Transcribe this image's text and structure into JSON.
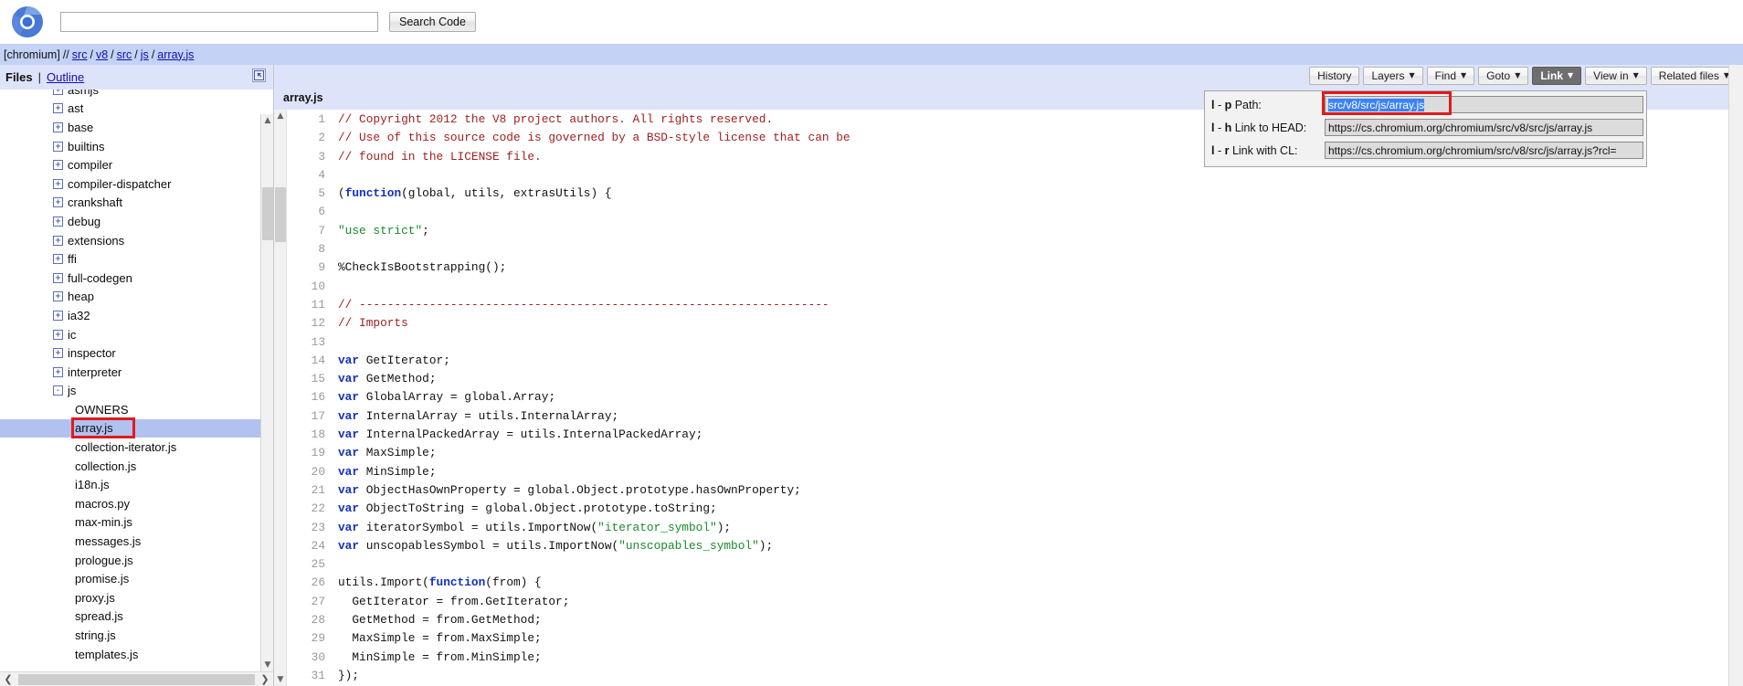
{
  "search": {
    "value": "",
    "placeholder": "",
    "button_label": "Search Code",
    "logo_icon": "chromium-logo-icon"
  },
  "breadcrumb": {
    "project": "[chromium]",
    "slashes": "//",
    "segments": [
      "src",
      "v8",
      "src",
      "js",
      "array.js"
    ]
  },
  "sidebar": {
    "files_label": "Files",
    "divider": "|",
    "outline_label": "Outline",
    "collapse_icon": "collapse-panel-icon",
    "items": [
      {
        "label": "asmjs",
        "type": "folder",
        "expander": "+",
        "indent": 0,
        "partial": true
      },
      {
        "label": "ast",
        "type": "folder",
        "expander": "+",
        "indent": 0
      },
      {
        "label": "base",
        "type": "folder",
        "expander": "+",
        "indent": 0
      },
      {
        "label": "builtins",
        "type": "folder",
        "expander": "+",
        "indent": 0
      },
      {
        "label": "compiler",
        "type": "folder",
        "expander": "+",
        "indent": 0
      },
      {
        "label": "compiler-dispatcher",
        "type": "folder",
        "expander": "+",
        "indent": 0
      },
      {
        "label": "crankshaft",
        "type": "folder",
        "expander": "+",
        "indent": 0
      },
      {
        "label": "debug",
        "type": "folder",
        "expander": "+",
        "indent": 0
      },
      {
        "label": "extensions",
        "type": "folder",
        "expander": "+",
        "indent": 0
      },
      {
        "label": "ffi",
        "type": "folder",
        "expander": "+",
        "indent": 0
      },
      {
        "label": "full-codegen",
        "type": "folder",
        "expander": "+",
        "indent": 0
      },
      {
        "label": "heap",
        "type": "folder",
        "expander": "+",
        "indent": 0
      },
      {
        "label": "ia32",
        "type": "folder",
        "expander": "+",
        "indent": 0
      },
      {
        "label": "ic",
        "type": "folder",
        "expander": "+",
        "indent": 0
      },
      {
        "label": "inspector",
        "type": "folder",
        "expander": "+",
        "indent": 0
      },
      {
        "label": "interpreter",
        "type": "folder",
        "expander": "+",
        "indent": 0
      },
      {
        "label": "js",
        "type": "folder",
        "expander": "-",
        "indent": 0
      },
      {
        "label": "OWNERS",
        "type": "file",
        "indent": 1
      },
      {
        "label": "array.js",
        "type": "file",
        "indent": 1,
        "selected": true,
        "annotated": true
      },
      {
        "label": "collection-iterator.js",
        "type": "file",
        "indent": 1
      },
      {
        "label": "collection.js",
        "type": "file",
        "indent": 1
      },
      {
        "label": "i18n.js",
        "type": "file",
        "indent": 1
      },
      {
        "label": "macros.py",
        "type": "file",
        "indent": 1
      },
      {
        "label": "max-min.js",
        "type": "file",
        "indent": 1
      },
      {
        "label": "messages.js",
        "type": "file",
        "indent": 1
      },
      {
        "label": "prologue.js",
        "type": "file",
        "indent": 1
      },
      {
        "label": "promise.js",
        "type": "file",
        "indent": 1
      },
      {
        "label": "proxy.js",
        "type": "file",
        "indent": 1
      },
      {
        "label": "spread.js",
        "type": "file",
        "indent": 1
      },
      {
        "label": "string.js",
        "type": "file",
        "indent": 1
      },
      {
        "label": "templates.js",
        "type": "file",
        "indent": 1,
        "partial": true
      }
    ],
    "hscroll_left_icon": "chevron-left-icon",
    "hscroll_right_icon": "chevron-right-icon"
  },
  "editor": {
    "file_tab_label": "array.js",
    "toolbar": [
      {
        "label": "History",
        "name": "history",
        "dropdown": false,
        "active": false
      },
      {
        "label": "Layers",
        "name": "layers",
        "dropdown": true,
        "active": false
      },
      {
        "label": "Find",
        "name": "find",
        "dropdown": true,
        "active": false
      },
      {
        "label": "Goto",
        "name": "goto",
        "dropdown": true,
        "active": false
      },
      {
        "label": "Link",
        "name": "link",
        "dropdown": true,
        "active": true
      },
      {
        "label": "View in",
        "name": "view-in",
        "dropdown": true,
        "active": false
      },
      {
        "label": "Related files",
        "name": "related-files",
        "dropdown": true,
        "active": false
      }
    ],
    "caret_glyph": "▼",
    "lines": [
      {
        "n": "1",
        "tokens": [
          {
            "t": "// Copyright 2012 the V8 project authors. All rights reserved.",
            "c": "com"
          }
        ]
      },
      {
        "n": "2",
        "tokens": [
          {
            "t": "// Use of this source code is governed by a BSD-style license that can be",
            "c": "com"
          }
        ]
      },
      {
        "n": "3",
        "tokens": [
          {
            "t": "// found in the LICENSE file.",
            "c": "com"
          }
        ]
      },
      {
        "n": "4",
        "tokens": []
      },
      {
        "n": "5",
        "tokens": [
          {
            "t": "(",
            "c": "txt"
          },
          {
            "t": "function",
            "c": "kw"
          },
          {
            "t": "(global, utils, extrasUtils) {",
            "c": "txt"
          }
        ]
      },
      {
        "n": "6",
        "tokens": []
      },
      {
        "n": "7",
        "tokens": [
          {
            "t": "\"use strict\"",
            "c": "str"
          },
          {
            "t": ";",
            "c": "txt"
          }
        ]
      },
      {
        "n": "8",
        "tokens": []
      },
      {
        "n": "9",
        "tokens": [
          {
            "t": "%CheckIsBootstrapping();",
            "c": "txt"
          }
        ]
      },
      {
        "n": "10",
        "tokens": []
      },
      {
        "n": "11",
        "tokens": [
          {
            "t": "// -------------------------------------------------------------------",
            "c": "com"
          }
        ]
      },
      {
        "n": "12",
        "tokens": [
          {
            "t": "// Imports",
            "c": "com"
          }
        ]
      },
      {
        "n": "13",
        "tokens": []
      },
      {
        "n": "14",
        "tokens": [
          {
            "t": "var",
            "c": "kw"
          },
          {
            "t": " GetIterator;",
            "c": "txt"
          }
        ]
      },
      {
        "n": "15",
        "tokens": [
          {
            "t": "var",
            "c": "kw"
          },
          {
            "t": " GetMethod;",
            "c": "txt"
          }
        ]
      },
      {
        "n": "16",
        "tokens": [
          {
            "t": "var",
            "c": "kw"
          },
          {
            "t": " GlobalArray = global.Array;",
            "c": "txt"
          }
        ]
      },
      {
        "n": "17",
        "tokens": [
          {
            "t": "var",
            "c": "kw"
          },
          {
            "t": " InternalArray = utils.InternalArray;",
            "c": "txt"
          }
        ]
      },
      {
        "n": "18",
        "tokens": [
          {
            "t": "var",
            "c": "kw"
          },
          {
            "t": " InternalPackedArray = utils.InternalPackedArray;",
            "c": "txt"
          }
        ]
      },
      {
        "n": "19",
        "tokens": [
          {
            "t": "var",
            "c": "kw"
          },
          {
            "t": " MaxSimple;",
            "c": "txt"
          }
        ]
      },
      {
        "n": "20",
        "tokens": [
          {
            "t": "var",
            "c": "kw"
          },
          {
            "t": " MinSimple;",
            "c": "txt"
          }
        ]
      },
      {
        "n": "21",
        "tokens": [
          {
            "t": "var",
            "c": "kw"
          },
          {
            "t": " ObjectHasOwnProperty = global.Object.prototype.hasOwnProperty;",
            "c": "txt"
          }
        ]
      },
      {
        "n": "22",
        "tokens": [
          {
            "t": "var",
            "c": "kw"
          },
          {
            "t": " ObjectToString = global.Object.prototype.toString;",
            "c": "txt"
          }
        ]
      },
      {
        "n": "23",
        "tokens": [
          {
            "t": "var",
            "c": "kw"
          },
          {
            "t": " iteratorSymbol = utils.ImportNow(",
            "c": "txt"
          },
          {
            "t": "\"iterator_symbol\"",
            "c": "str"
          },
          {
            "t": ");",
            "c": "txt"
          }
        ]
      },
      {
        "n": "24",
        "tokens": [
          {
            "t": "var",
            "c": "kw"
          },
          {
            "t": " unscopablesSymbol = utils.ImportNow(",
            "c": "txt"
          },
          {
            "t": "\"unscopables_symbol\"",
            "c": "str"
          },
          {
            "t": ");",
            "c": "txt"
          }
        ]
      },
      {
        "n": "25",
        "tokens": []
      },
      {
        "n": "26",
        "tokens": [
          {
            "t": "utils.Import(",
            "c": "txt"
          },
          {
            "t": "function",
            "c": "kw"
          },
          {
            "t": "(from) {",
            "c": "txt"
          }
        ]
      },
      {
        "n": "27",
        "tokens": [
          {
            "t": "  GetIterator = from.GetIterator;",
            "c": "txt"
          }
        ]
      },
      {
        "n": "28",
        "tokens": [
          {
            "t": "  GetMethod = from.GetMethod;",
            "c": "txt"
          }
        ]
      },
      {
        "n": "29",
        "tokens": [
          {
            "t": "  MaxSimple = from.MaxSimple;",
            "c": "txt"
          }
        ]
      },
      {
        "n": "30",
        "tokens": [
          {
            "t": "  MinSimple = from.MinSimple;",
            "c": "txt"
          }
        ]
      },
      {
        "n": "31",
        "tokens": [
          {
            "t": "});",
            "c": "txt"
          }
        ]
      }
    ]
  },
  "link_panel": {
    "rows": [
      {
        "shortcut_key": "l",
        "shortcut_sep": "-",
        "shortcut_mod": "p",
        "label": "Path:",
        "value": "src/v8/src/js/array.js",
        "selected": true,
        "annotated": true,
        "name": "path"
      },
      {
        "shortcut_key": "l",
        "shortcut_sep": "-",
        "shortcut_mod": "h",
        "label": "Link to HEAD:",
        "value": "https://cs.chromium.org/chromium/src/v8/src/js/array.js",
        "selected": false,
        "annotated": false,
        "name": "link-to-head"
      },
      {
        "shortcut_key": "l",
        "shortcut_sep": "-",
        "shortcut_mod": "r",
        "label": "Link with CL:",
        "value": "https://cs.chromium.org/chromium/src/v8/src/js/array.js?rcl=",
        "selected": false,
        "annotated": false,
        "name": "link-with-cl"
      }
    ]
  },
  "colors": {
    "breadcrumb_bg": "#c3d2f5",
    "panel_header_bg": "#dde4fa",
    "selection_bg": "#b2c2f0",
    "annotation_red": "#e01b1b",
    "link_blue": "#1a0dab",
    "active_button_bg": "#6e6e6e",
    "text_selection_blue": "#3b82f6",
    "comment_red": "#a02020",
    "keyword_blue": "#1230c0",
    "string_green": "#1a8a2a"
  }
}
